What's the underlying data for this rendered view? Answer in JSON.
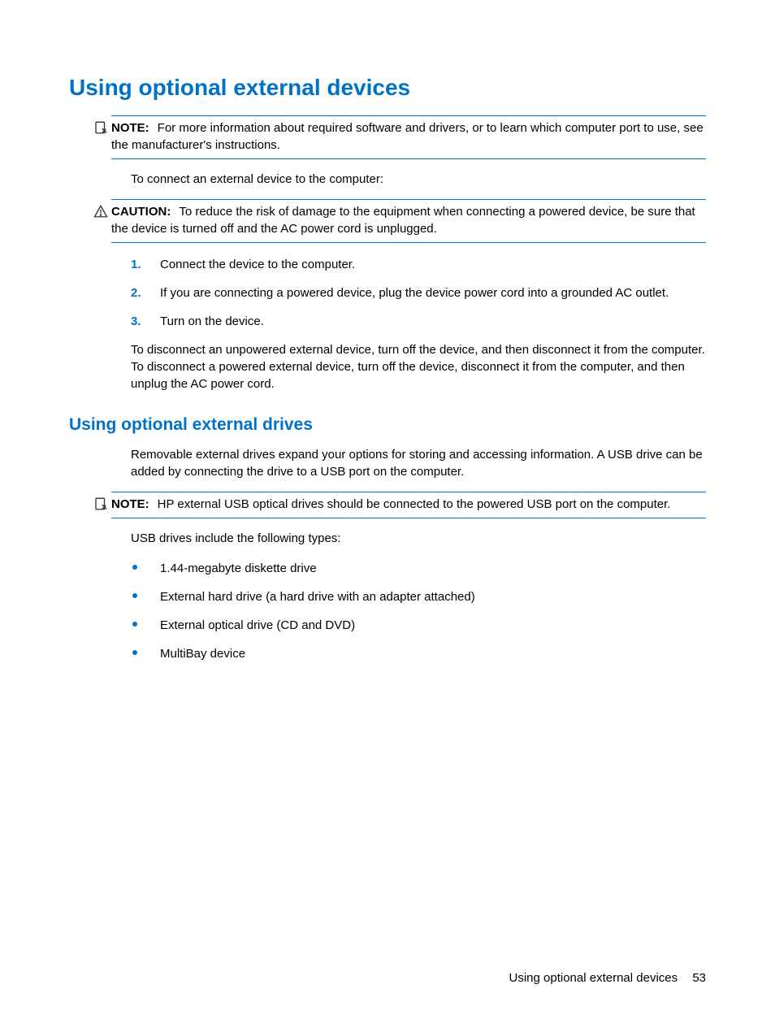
{
  "heading1": "Using optional external devices",
  "note1_label": "NOTE:",
  "note1_text": "For more information about required software and drivers, or to learn which computer port to use, see the manufacturer's instructions.",
  "intro1": "To connect an external device to the computer:",
  "caution_label": "CAUTION:",
  "caution_text": "To reduce the risk of damage to the equipment when connecting a powered device, be sure that the device is turned off and the AC power cord is unplugged.",
  "steps": [
    "Connect the device to the computer.",
    "If you are connecting a powered device, plug the device power cord into a grounded AC outlet.",
    "Turn on the device."
  ],
  "disconnect_text": "To disconnect an unpowered external device, turn off the device, and then disconnect it from the computer. To disconnect a powered external device, turn off the device, disconnect it from the computer, and then unplug the AC power cord.",
  "heading2": "Using optional external drives",
  "drives_intro": "Removable external drives expand your options for storing and accessing information. A USB drive can be added by connecting the drive to a USB port on the computer.",
  "note2_label": "NOTE:",
  "note2_text": "HP external USB optical drives should be connected to the powered USB port on the computer.",
  "usb_intro": "USB drives include the following types:",
  "bullets": [
    "1.44-megabyte diskette drive",
    "External hard drive (a hard drive with an adapter attached)",
    "External optical drive (CD and DVD)",
    "MultiBay device"
  ],
  "footer_title": "Using optional external devices",
  "footer_page": "53"
}
